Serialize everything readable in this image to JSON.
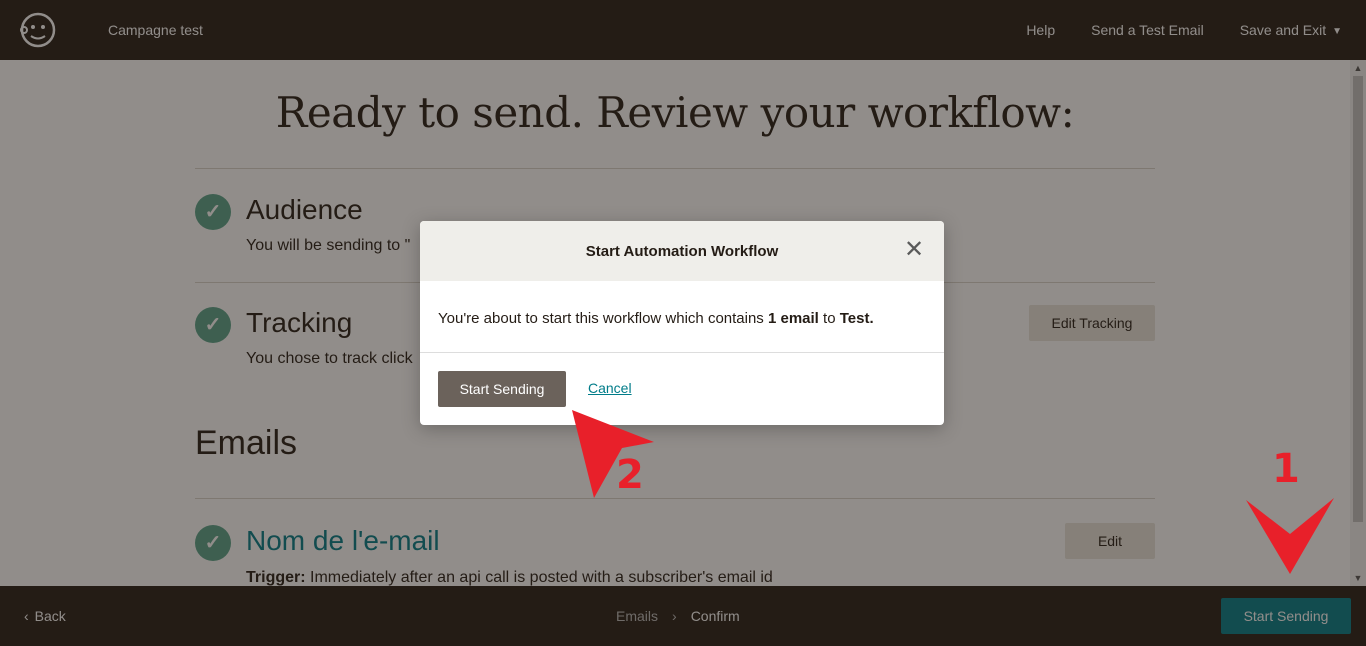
{
  "header": {
    "campaign_name": "Campagne test",
    "links": {
      "help": "Help",
      "send_test": "Send a Test Email",
      "save_exit": "Save and Exit"
    }
  },
  "main": {
    "title": "Ready to send. Review your workflow:",
    "audience": {
      "title": "Audience",
      "desc": "You will be sending to \""
    },
    "tracking": {
      "title": "Tracking",
      "desc": "You chose to track click",
      "edit_label": "Edit Tracking"
    },
    "emails_heading": "Emails",
    "email": {
      "name": "Nom de l'e-mail",
      "edit_label": "Edit",
      "trigger_label": "Trigger:",
      "trigger_text": "Immediately after an api call is posted with a subscriber's email id"
    }
  },
  "footer": {
    "back_label": "Back",
    "breadcrumb": [
      "Emails",
      "Confirm"
    ],
    "primary_label": "Start Sending"
  },
  "modal": {
    "title": "Start Automation Workflow",
    "body_prefix": "You're about to start this workflow which contains ",
    "body_count": "1 email",
    "body_mid": " to ",
    "body_audience": "Test.",
    "primary_label": "Start Sending",
    "cancel_label": "Cancel"
  },
  "annotations": {
    "step1": "1",
    "step2": "2",
    "color": "#e8202a"
  },
  "colors": {
    "brand_dark": "#241c15",
    "accent_teal": "#007c89",
    "check_green": "#58a38b"
  },
  "icons": {
    "logo": "mailchimp-freddie-icon",
    "close": "close-icon",
    "check": "check-icon"
  }
}
